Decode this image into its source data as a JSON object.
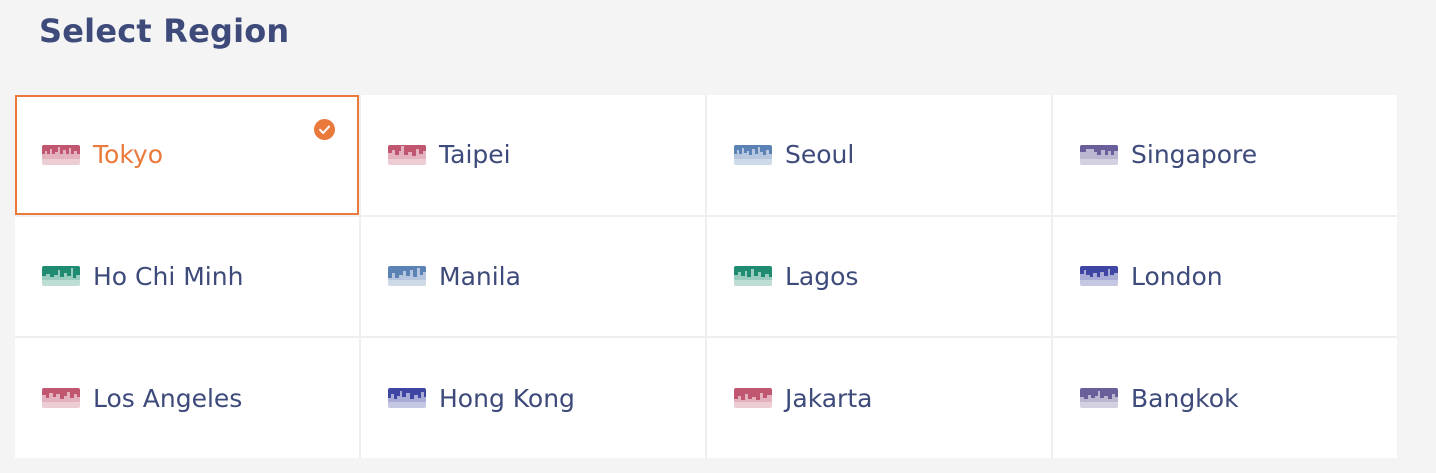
{
  "title": "Select Region",
  "colors": {
    "accent": "#ea7a3b",
    "text": "#3d4a7a",
    "background": "#f4f4f4"
  },
  "selected_region": "Tokyo",
  "regions": [
    {
      "label": "Tokyo",
      "icon": "tokyo-skyline-icon",
      "color": "#c0566f",
      "selected": true
    },
    {
      "label": "Taipei",
      "icon": "taipei-skyline-icon",
      "color": "#c0566f",
      "selected": false
    },
    {
      "label": "Seoul",
      "icon": "seoul-skyline-icon",
      "color": "#5b82b5",
      "selected": false
    },
    {
      "label": "Singapore",
      "icon": "singapore-skyline-icon",
      "color": "#6a5f9a",
      "selected": false
    },
    {
      "label": "Ho Chi Minh",
      "icon": "ho-chi-minh-skyline-icon",
      "color": "#1f8c72",
      "selected": false
    },
    {
      "label": "Manila",
      "icon": "manila-skyline-icon",
      "color": "#5b82b5",
      "selected": false
    },
    {
      "label": "Lagos",
      "icon": "lagos-skyline-icon",
      "color": "#1f8c72",
      "selected": false
    },
    {
      "label": "London",
      "icon": "london-skyline-icon",
      "color": "#3f45a3",
      "selected": false
    },
    {
      "label": "Los Angeles",
      "icon": "los-angeles-skyline-icon",
      "color": "#c0566f",
      "selected": false
    },
    {
      "label": "Hong Kong",
      "icon": "hong-kong-skyline-icon",
      "color": "#3f45a3",
      "selected": false
    },
    {
      "label": "Jakarta",
      "icon": "jakarta-skyline-icon",
      "color": "#c0566f",
      "selected": false
    },
    {
      "label": "Bangkok",
      "icon": "bangkok-skyline-icon",
      "color": "#6a5f9a",
      "selected": false
    }
  ]
}
